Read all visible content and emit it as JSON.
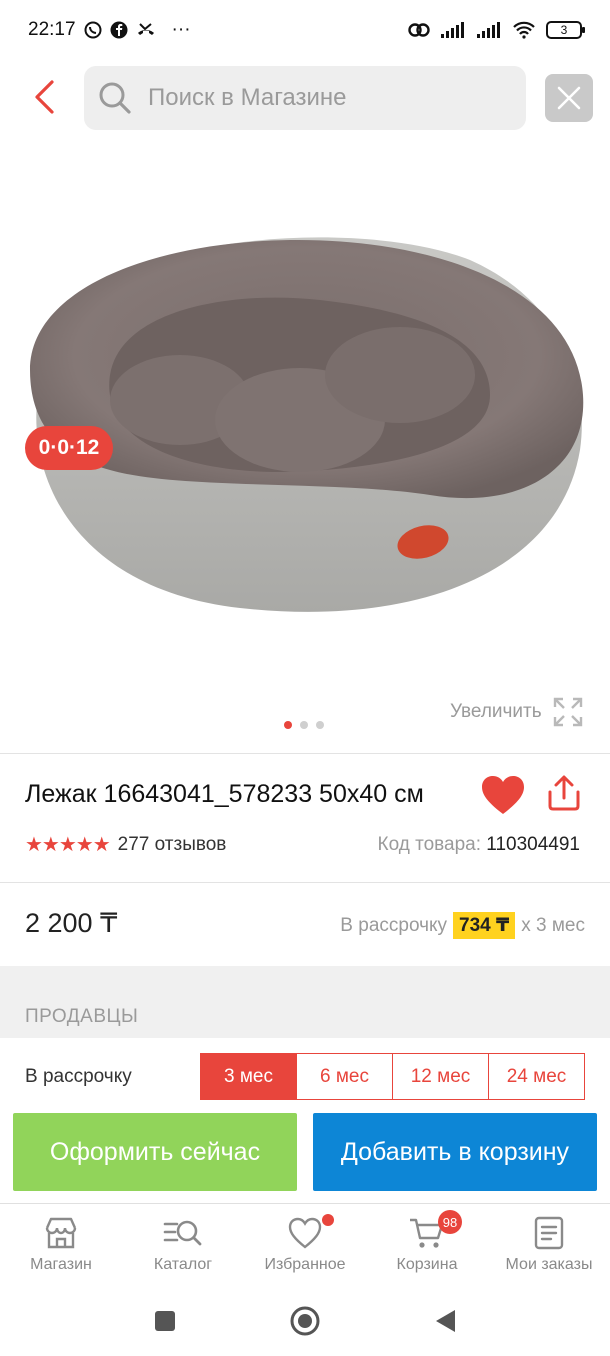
{
  "status_bar": {
    "time": "22:17",
    "more": "···",
    "battery": "3"
  },
  "search": {
    "placeholder": "Поиск в Магазине"
  },
  "product": {
    "timer": "0·0·12",
    "zoom_label": "Увеличить",
    "title": "Лежак 16643041_578233 50x40 см",
    "stars": "★★★★★",
    "rating": 5,
    "reviews": "277 отзывов",
    "sku_label": "Код товара:",
    "sku_value": "110304491",
    "price": "2 200 ₸",
    "installment_prefix": "В рассрочку",
    "installment_amount": "734 ₸",
    "installment_suffix": "x 3 мес",
    "image_dots": 3,
    "active_dot": 0
  },
  "sellers": {
    "section_title": "ПРОДАВЦЫ",
    "installment_label": "В рассрочку",
    "tabs": [
      "3 мес",
      "6 мес",
      "12 мес",
      "24 мес"
    ],
    "active_tab": 0
  },
  "actions": {
    "buy_now": "Оформить сейчас",
    "add_to_cart": "Добавить в корзину"
  },
  "bottom_nav": [
    {
      "label": "Магазин",
      "icon": "store-icon"
    },
    {
      "label": "Каталог",
      "icon": "catalog-search-icon"
    },
    {
      "label": "Избранное",
      "icon": "heart-outline-icon"
    },
    {
      "label": "Корзина",
      "icon": "cart-icon",
      "badge": "98"
    },
    {
      "label": "Мои заказы",
      "icon": "orders-icon"
    }
  ],
  "colors": {
    "accent_red": "#e8453c",
    "buy_green": "#91d45a",
    "cart_blue": "#0d86d6",
    "installment_yellow": "#ffd21f"
  }
}
